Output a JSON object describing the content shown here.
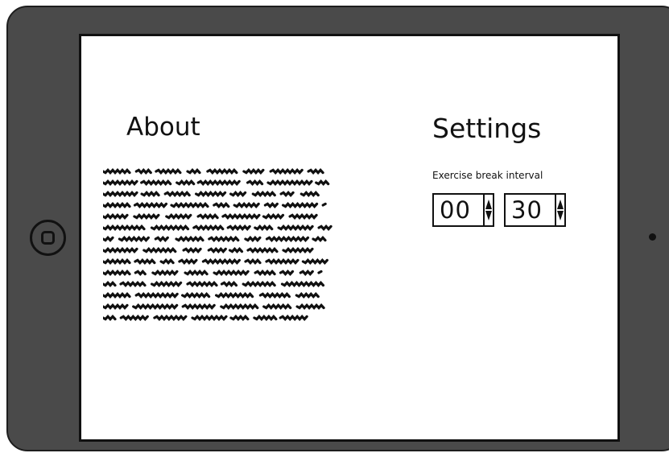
{
  "about": {
    "title": "About"
  },
  "settings": {
    "title": "Settings",
    "interval_label": "Exercise break interval",
    "hours_value": "00",
    "minutes_value": "30"
  },
  "icons": {
    "home": "home-button-icon",
    "camera": "camera-dot-icon",
    "spin_up": "arrow-up-icon",
    "spin_down": "arrow-down-icon"
  }
}
